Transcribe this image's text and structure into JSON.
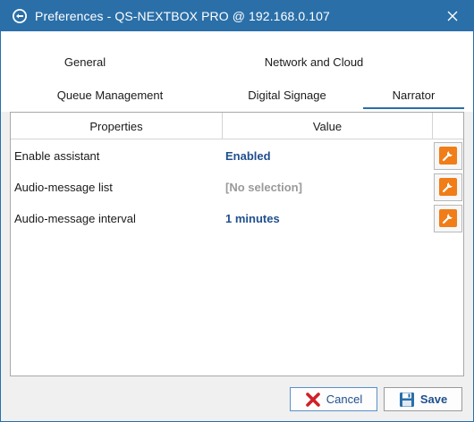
{
  "window": {
    "title": "Preferences - QS-NEXTBOX PRO @ 192.168.0.107",
    "accent_color": "#2a6fa8"
  },
  "tabs": [
    {
      "label": "General",
      "active": false
    },
    {
      "label": "Network and Cloud",
      "active": false
    },
    {
      "label": "Queue Management",
      "active": false
    },
    {
      "label": "Digital Signage",
      "active": false
    },
    {
      "label": "Narrator",
      "active": true
    }
  ],
  "grid": {
    "headers": [
      "Properties",
      "Value"
    ],
    "rows": [
      {
        "label": "Enable assistant",
        "value": "Enabled",
        "value_style": "blue"
      },
      {
        "label": "Audio-message list",
        "value": "[No selection]",
        "value_style": "gray"
      },
      {
        "label": "Audio-message interval",
        "value": "1 minutes",
        "value_style": "blue"
      }
    ],
    "row_button_icon": "wrench-icon",
    "row_button_color": "#f07d18"
  },
  "footer": {
    "cancel_label": "Cancel",
    "save_label": "Save"
  }
}
